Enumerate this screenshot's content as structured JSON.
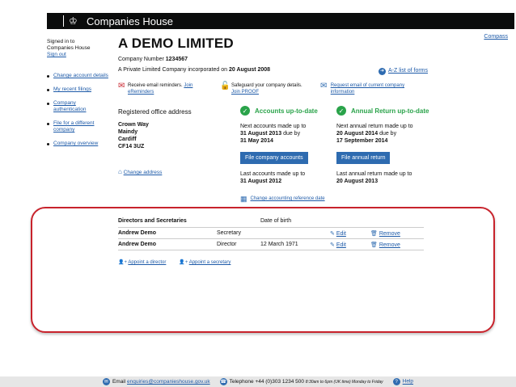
{
  "header": {
    "brand": "Companies House"
  },
  "top_link": "Compass",
  "sidebar": {
    "signed_in_line1": "Signed in to",
    "signed_in_line2": "Companies House",
    "sign_out": "Sign out",
    "items": [
      {
        "label": "Change account details"
      },
      {
        "label": "My recent filings"
      },
      {
        "label": "Company authentication"
      },
      {
        "label": "File for a different company"
      },
      {
        "label": "Company overview"
      }
    ]
  },
  "company": {
    "name": "A DEMO LIMITED",
    "number_label": "Company Number",
    "number": "1234567",
    "type_text": "A Private Limited Company incorporated on",
    "incorporated": "20 August 2008",
    "az_link": "A-Z list of forms"
  },
  "notices": {
    "ereminders_text": "Receive email reminders.",
    "ereminders_join": "Join eReminders",
    "proof_text": "Safeguard your company details.",
    "proof_join": "Join PROOF",
    "email_request": "Request email of current company information"
  },
  "office": {
    "heading": "Registered office address",
    "line1": "Crown Way",
    "line2": "Maindy",
    "line3": "Cardiff",
    "line4": "CF14 3UZ",
    "change_link": "Change address"
  },
  "accounts": {
    "status": "Accounts up-to-date",
    "next_label": "Next accounts made up to",
    "next_date": "31 August 2013",
    "due_by": "due by",
    "due_date": "31 May 2014",
    "button": "File company accounts",
    "last_label": "Last accounts made up to",
    "last_date": "31 August 2012",
    "change_ref": "Change accounting reference date"
  },
  "annual": {
    "status": "Annual Return up-to-date",
    "next_label": "Next annual return made up to",
    "next_date": "20 August 2014",
    "due_by": "due by",
    "due_date": "17 September 2014",
    "button": "File annual return",
    "last_label": "Last annual return made up to",
    "last_date": "20 August 2013"
  },
  "officers": {
    "col_name": "Directors and Secretaries",
    "col_dob": "Date of birth",
    "rows": [
      {
        "name": "Andrew Demo",
        "role": "Secretary",
        "dob": "",
        "edit": "Edit",
        "remove": "Remove"
      },
      {
        "name": "Andrew Demo",
        "role": "Director",
        "dob": "12 March 1971",
        "edit": "Edit",
        "remove": "Remove"
      }
    ],
    "appoint_director": "Appoint a director",
    "appoint_secretary": "Appoint a secretary"
  },
  "footer": {
    "email_label": "Email",
    "email": "enquiries@companieshouse.gov.uk",
    "phone_label": "Telephone",
    "phone": "+44 (0)303 1234 500",
    "hours": "8:30am to 6pm (UK time) Monday to Friday",
    "help": "Help"
  },
  "colors": {
    "accent": "#2e6bb0",
    "success": "#2aa34a",
    "highlight": "#c8232c",
    "header_bg": "#0b0c0c"
  }
}
